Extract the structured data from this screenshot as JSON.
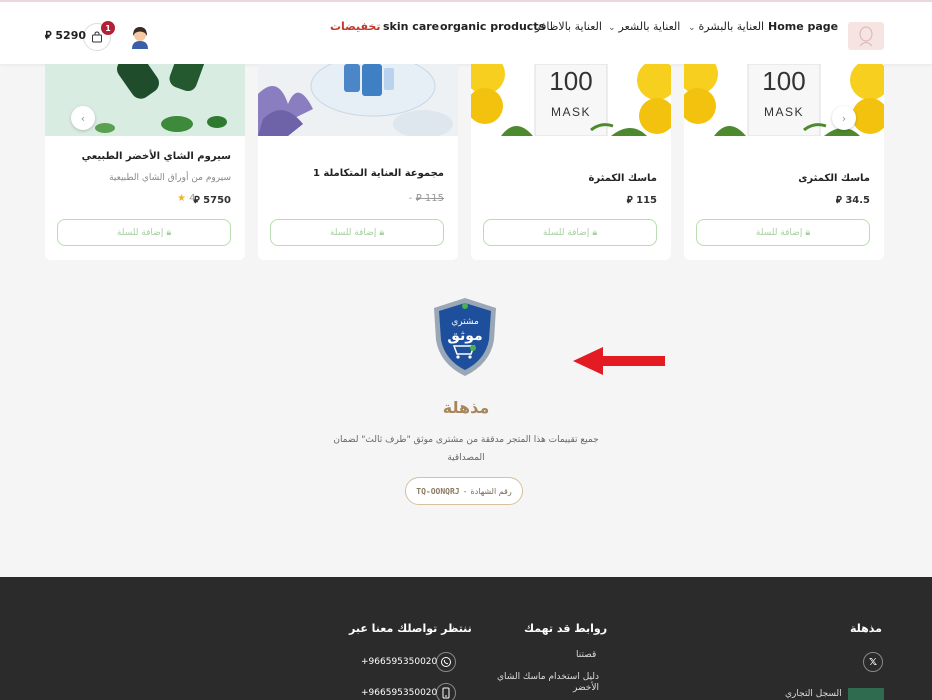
{
  "header": {
    "nav": {
      "sale": "تخفيضات",
      "skin_care_en": "skin care",
      "organic": "organic products",
      "nails": "العناية بالاظافر",
      "hair": "العناية بالشعر",
      "skin": "العناية بالبشرة",
      "home": "Home page"
    },
    "cart": {
      "count": "1",
      "total": "5290",
      "currency": "⃁"
    }
  },
  "products": [
    {
      "name": "ماسك الكمثرى",
      "price": "34.5",
      "button": "إضافة للسلة"
    },
    {
      "name": "ماسك الكمثرة",
      "price": "115",
      "button": "إضافة للسلة"
    },
    {
      "name": "مجموعة العناية المتكاملة 1",
      "old_price": "115",
      "price_dash": "-",
      "button": "إضافة للسلة"
    },
    {
      "name": "سيروم الشاي الأخضر الطبيعي",
      "description": "سيروم من أوراق الشاي الطبيعية",
      "price": "5750",
      "rating": "4",
      "button": "إضافة للسلة"
    }
  ],
  "mask_text": {
    "number": "100",
    "label": "MASK"
  },
  "trust": {
    "badge_line1": "مشتري",
    "badge_line2": "موثق",
    "title": "مذهلة",
    "description": "جميع تقييمات هذا المتجر مدققة من مشترى موثق \"طرف ثالث\" لضمان المصداقية",
    "cert_label": "رقم الشهادة",
    "cert_separator": "-",
    "cert_code": "TQ-OONQRJ"
  },
  "footer": {
    "brand": "مذهلة",
    "links_heading": "روابط قد تهمك",
    "links": [
      "قصتنا",
      "دليل استخدام ماسك الشاي الأخضر"
    ],
    "contact_heading": "ننتظر تواصلك معنا عبر",
    "phones": [
      "+966595350020",
      "+966595350020"
    ],
    "commercial_register": "السجل التجاري"
  },
  "colors": {
    "sale": "#c0392b",
    "accent_gold": "#a8865c",
    "button_green": "#b9dcb3",
    "footer_bg": "#2b2b2b",
    "badge": "#b22234"
  }
}
